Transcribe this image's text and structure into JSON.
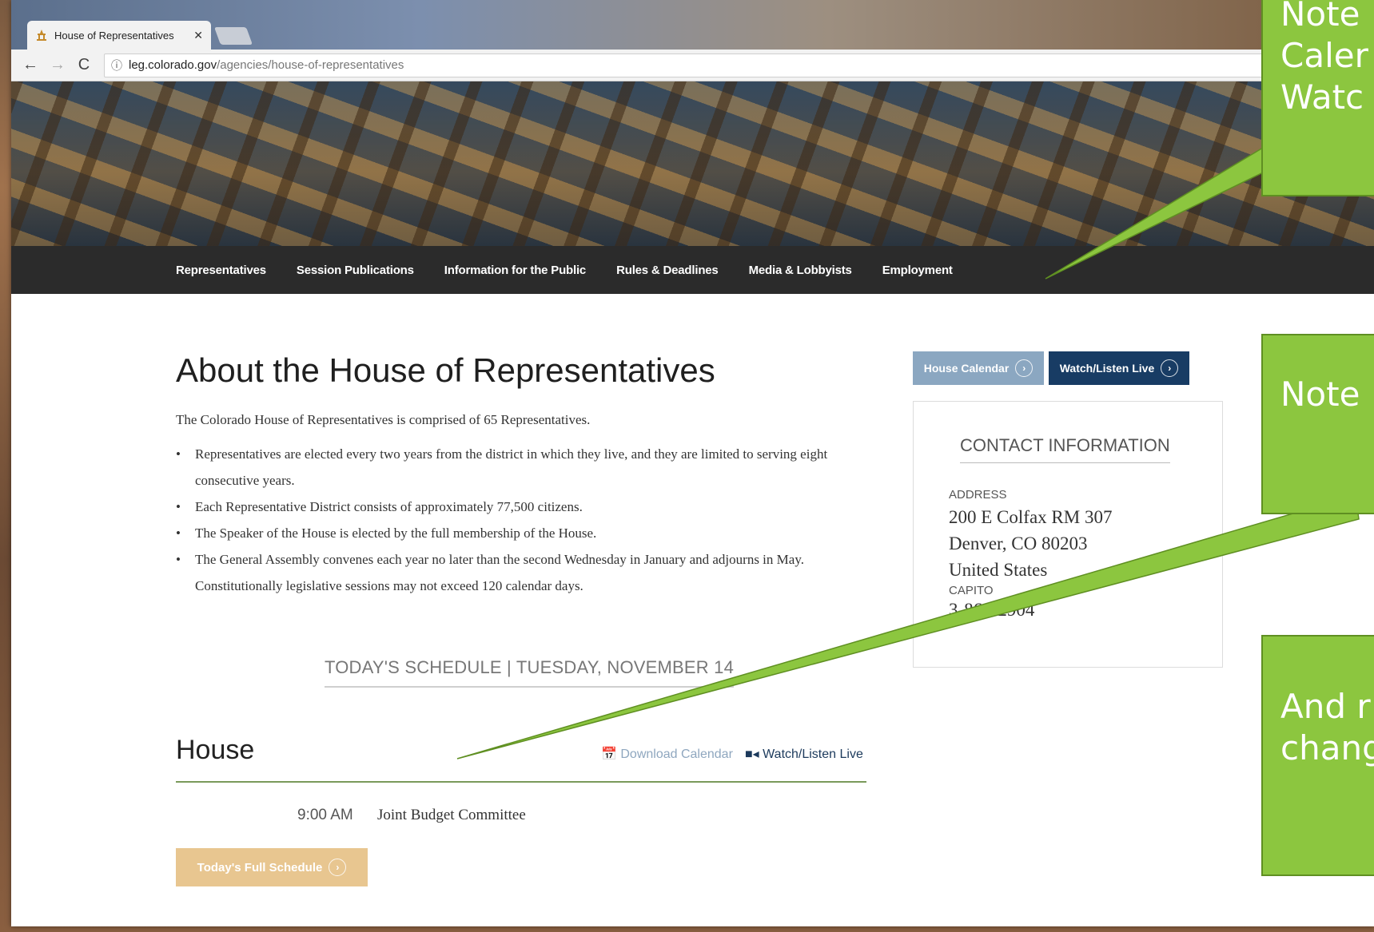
{
  "browser": {
    "tab_title": "House of Representatives",
    "url_host": "leg.colorado.gov",
    "url_path": "/agencies/house-of-representatives"
  },
  "nav": {
    "items": [
      "Representatives",
      "Session Publications",
      "Information for the Public",
      "Rules & Deadlines",
      "Media & Lobbyists",
      "Employment"
    ]
  },
  "main": {
    "title": "About the House of Representatives",
    "intro": "The Colorado House of Representatives is comprised of 65 Representatives.",
    "bullets": [
      "Representatives are elected every two years from the district in which they live, and they are limited to serving eight consecutive years.",
      "Each Representative District consists of approximately 77,500 citizens.",
      "The Speaker of the House is elected by the full membership of the House.",
      "The General Assembly convenes each year no later than the second Wednesday in January and adjourns in May.  Constitutionally legislative sessions may not exceed 120 calendar days."
    ],
    "schedule_heading": "TODAY'S SCHEDULE | TUESDAY, NOVEMBER 14",
    "house_title": "House",
    "download_calendar": "Download Calendar",
    "watch_listen": "Watch/Listen Live",
    "event_time": "9:00 AM",
    "event_name": "Joint Budget Committee",
    "full_schedule_button": "Today's Full Schedule"
  },
  "sidebar": {
    "house_calendar_button": "House Calendar",
    "watch_button": "Watch/Listen Live",
    "contact_title": "CONTACT INFORMATION",
    "address_label": "ADDRESS",
    "address_lines": [
      "200 E Colfax RM 307",
      "Denver, CO 80203",
      "United States"
    ],
    "capitol_label": "CAPITO",
    "phone": "3-866-2904"
  },
  "callouts": {
    "first_lines": [
      "Note",
      "Caler",
      "Watc"
    ],
    "second": "Note",
    "third_lines": [
      "And r",
      "chang"
    ]
  },
  "colors": {
    "callout_green": "#8cc63f",
    "nav_bg": "#2b2b2b",
    "calendar_btn": "#8ba7c1",
    "watch_btn": "#183c64",
    "full_schedule_btn": "#e8c690"
  }
}
